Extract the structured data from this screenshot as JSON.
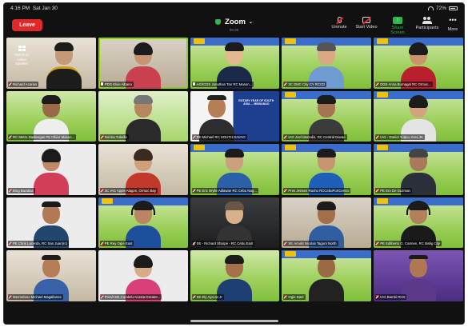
{
  "status_bar": {
    "time": "4:16 PM",
    "date": "Sat Jan 30",
    "battery": "72%"
  },
  "toolbar": {
    "leave_label": "Leave",
    "meeting_title": "Zoom",
    "timer": "00:36",
    "buttons": [
      {
        "label": "Unmute",
        "icon": "microphone-muted-icon"
      },
      {
        "label": "Start Video",
        "icon": "video-off-icon"
      },
      {
        "label": "Share Screen",
        "icon": "share-screen-icon"
      },
      {
        "label": "Participants",
        "icon": "participants-icon"
      },
      {
        "label": "More",
        "icon": "more-icon"
      }
    ]
  },
  "switch_speaker": {
    "label_line1": "Switch to",
    "label_line2": "Active Speaker"
  },
  "slide": {
    "title": "ROTARY YEAR OF SOUTH ASIA ... MINDANAO"
  },
  "accent_colors": {
    "leave": "#e02828",
    "active_speaker": "#8fd300",
    "share": "#2bb74c"
  },
  "participants": [
    {
      "name": "Richard Acarias",
      "muted": true
    },
    {
      "name": "PDG Elvie Albano",
      "muted": false
    },
    {
      "name": "AG/ICDS Jonathan Tan RC Mason...",
      "muted": false
    },
    {
      "name": "3C DMC City CY RCCD",
      "muted": true
    },
    {
      "name": "DGE Anna Burnagal RC Ormoc...",
      "muted": true
    },
    {
      "name": "RC Metro Dadiangas PE Oliver Mason...",
      "muted": true
    },
    {
      "name": "Norma Tubelle",
      "muted": true
    },
    {
      "name": "PE Michael RC SOUTH DAVAO",
      "muted": true
    },
    {
      "name": "IAG Joel Merindis, RC Central Davao",
      "muted": true
    },
    {
      "name": "IAG - Daniel Yulpco Area 3K",
      "muted": true
    },
    {
      "name": "Bing Barabas",
      "muted": true
    },
    {
      "name": "3C IAG Apple Alagon, Ormoc Bay",
      "muted": true
    },
    {
      "name": "PE Eric Brylle Adlawan RC Cebu Nag...",
      "muted": true
    },
    {
      "name": "Pres Jensen Racho RCCebuPortCentro",
      "muted": true
    },
    {
      "name": "PE Ero De Guzman",
      "muted": true
    },
    {
      "name": "PE Chris Lacerda, RC San Juan(rc)",
      "muted": true
    },
    {
      "name": "PE Rey Ogle East",
      "muted": true
    },
    {
      "name": "SE - Richard Sharpe - RC Cebu East",
      "muted": true
    },
    {
      "name": "SE Arnold Nicolas Tagum North",
      "muted": true
    },
    {
      "name": "PE Edilberto G. Carmen, RC Bislig City",
      "muted": true
    },
    {
      "name": "Mermelano Michael Magallanes",
      "muted": true
    },
    {
      "name": "Pres/ASE-Candelu Acosta-Greater...",
      "muted": true
    },
    {
      "name": "SE Ely Aya-an Jr",
      "muted": true
    },
    {
      "name": "Ogie Dael",
      "muted": true
    },
    {
      "name": "IAG Bambi RCD",
      "muted": true
    }
  ]
}
